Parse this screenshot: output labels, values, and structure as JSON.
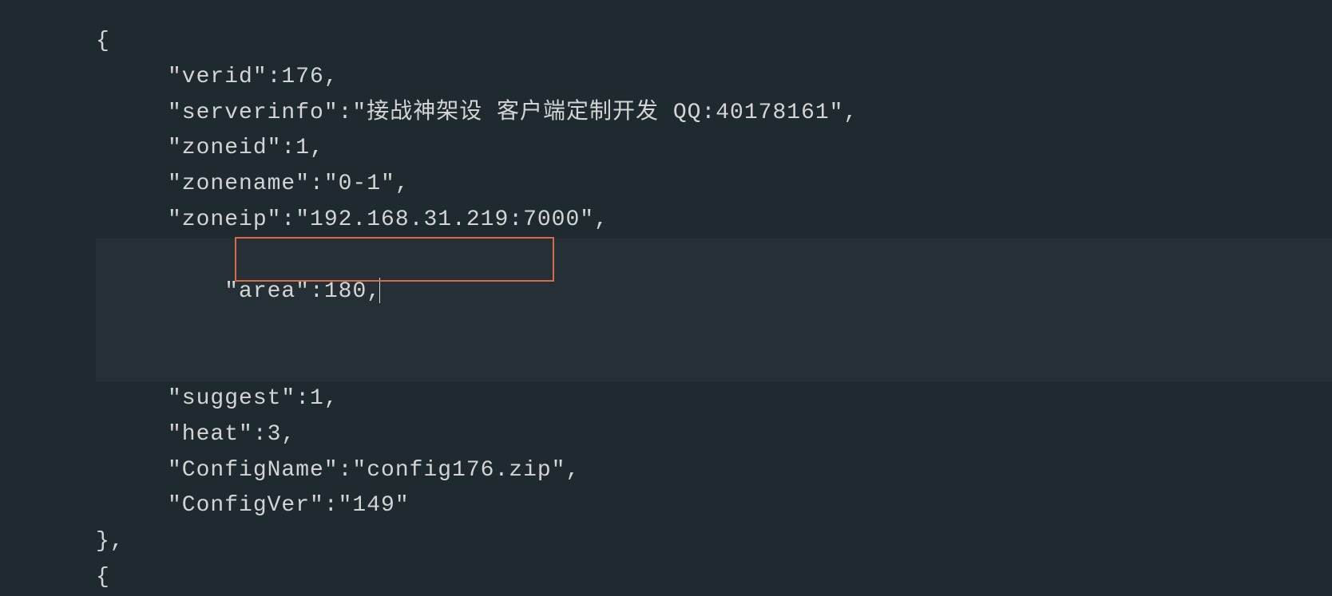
{
  "code": {
    "open_brace": "{",
    "lines": {
      "verid": "\"verid\":176,",
      "serverinfo": "\"serverinfo\":\"接战神架设 客户端定制开发 QQ:40178161\",",
      "zoneid": "\"zoneid\":1,",
      "zonename": "\"zonename\":\"0-1\",",
      "zoneip": "\"zoneip\":\"192.168.31.219:7000\",",
      "area": "\"area\":180,",
      "suggest": "\"suggest\":1,",
      "heat": "\"heat\":3,",
      "ConfigName": "\"ConfigName\":\"config176.zip\",",
      "ConfigVer": "\"ConfigVer\":\"149\""
    },
    "close_brace": "},",
    "next_open": "{"
  }
}
